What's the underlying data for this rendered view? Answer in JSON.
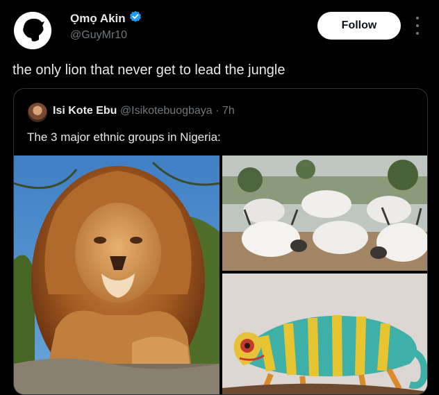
{
  "author": {
    "display_name": "Ọmọ Akin",
    "handle": "@GuyMr10",
    "avatar_icon": "silhouette-avatar-icon",
    "verified_icon": "verified-badge-icon"
  },
  "actions": {
    "follow_label": "Follow",
    "more_icon": "more-vertical-icon"
  },
  "tweet": {
    "text": "the only lion that never get to lead the jungle"
  },
  "quote": {
    "display_name": "Isi Kote Ebu",
    "handle": "@Isikotebuogbaya",
    "separator": "·",
    "time": "7h",
    "text": "The 3 major ethnic groups in Nigeria:",
    "images": [
      {
        "subject": "lion"
      },
      {
        "subject": "cattle herd"
      },
      {
        "subject": "chameleon"
      }
    ]
  },
  "colors": {
    "background": "#000000",
    "text_primary": "#e7e9ea",
    "text_secondary": "#71767b",
    "verified": "#1d9bf0",
    "follow_bg": "#ffffff",
    "border": "#2f3336"
  }
}
